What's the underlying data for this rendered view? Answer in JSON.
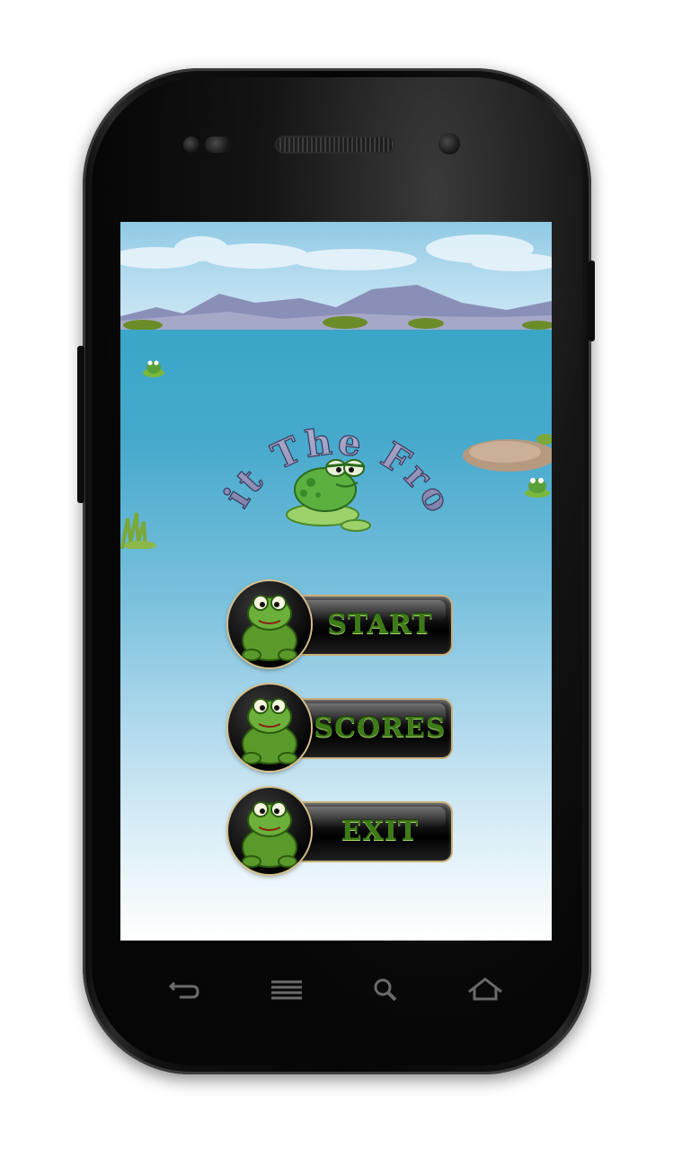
{
  "app": {
    "title": "Hit The Frog"
  },
  "menu": {
    "start_label": "START",
    "scores_label": "SCORES",
    "exit_label": "EXIT"
  },
  "navbar": {
    "icons": [
      "back-icon",
      "menu-icon",
      "search-icon",
      "home-icon"
    ]
  },
  "colors": {
    "label_green": "#3d7a18",
    "water": "#46a9cc",
    "phone_body": "#0b0b0b"
  }
}
